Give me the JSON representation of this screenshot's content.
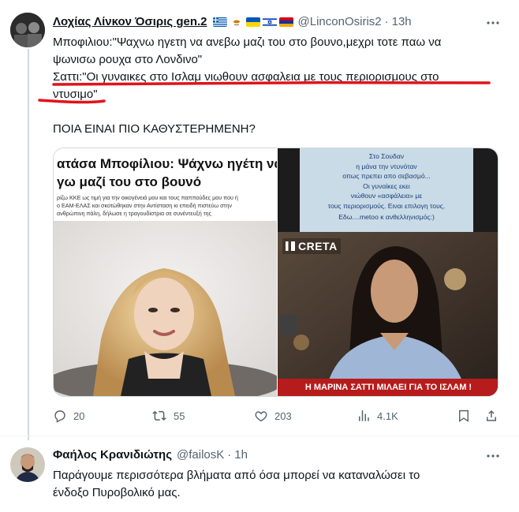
{
  "tweet1": {
    "display_name": "Λοχίας Λίνκον Όσιρις gen.2",
    "handle": "@LinconOsiris2",
    "separator": "·",
    "time": "13h",
    "avatar_icon": "profile-photo-icon",
    "flags": [
      "greece-flag-icon",
      "cyprus-flag-icon",
      "ukraine-flag-icon",
      "israel-flag-icon",
      "armenia-flag-icon"
    ],
    "lines": [
      "Μποφιλιου:\"Ψαχνω ηγετη να ανεβω μαζι του στο βουνο,μεχρι τοτε παω να",
      "ψωνισω ρουχα στο Λονδινο\"",
      "Σαττι:\"Οι γυναικες στο Ισλαμ νιωθουν ασφαλεια με τους περιορισμους στο",
      "ντυσιμο\""
    ],
    "question": "ΠΟΙΑ ΕΙΝΑΙ ΠΙΟ ΚΑΘΥΣΤΕΡΗΜΕΝΗ?",
    "media_left": {
      "headline_line1": "ατάσα Μποφίλιου: Ψάχνω ηγέτη να",
      "headline_line2": "γω μαζί του στο βουνό",
      "body_lines": [
        "ρίζω ΚΚΕ ως τιμή για την οικογένειά μου και τους παππούδες μου που ή",
        "ο ΕΑΜ-ΕΛΑΣ και σκοτώθηκαν στην Αντίσταση κι επειδή πιστεύω στην",
        "ανθρώπινη πάλη, δήλωσε η τραγουδίστρια σε συνέντευξή της"
      ]
    },
    "media_right": {
      "caption_lines": [
        "Στο Σουδαν",
        "η μάνα την ντυνόταν",
        "οπως πρεπει απο σεβασμό...",
        "Οι γυναίκες εκει",
        "νιώθουν «ασφάλεια» με",
        "τους περιορισμούς. Ειναι επιλογη τους.",
        "Εδω....metoo κ ανθελληνισμός:)"
      ],
      "channel_logo": "CRETA",
      "bottom_banner": "Η ΜΑΡΙΝΑ ΣΑΤΤΙ ΜΙΛΑΕΙ ΓΙΑ ΤΟ ΙΣΛΑΜ !"
    },
    "stats": {
      "replies": "20",
      "reposts": "55",
      "likes": "203",
      "views": "4.1K"
    },
    "accent_underline_color": "#e0131b"
  },
  "tweet2": {
    "display_name": "Φαήλος Κρανιδιώτης",
    "handle": "@failosK",
    "separator": "·",
    "time": "1h",
    "avatar_icon": "profile-photo-icon",
    "lines": [
      "Παράγουμε περισσότερα βλήματα από όσα μπορεί να καταναλώσει το",
      "ένδοξο Πυροβολικό μας."
    ]
  }
}
